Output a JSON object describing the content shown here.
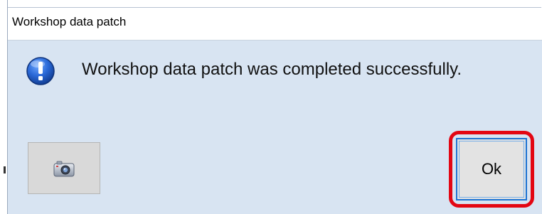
{
  "window": {
    "title": "Workshop data patch"
  },
  "message": {
    "icon": "info-exclamation-icon",
    "text": "Workshop data patch was completed successfully."
  },
  "buttons": {
    "camera_icon": "camera-icon",
    "ok_label": "Ok"
  },
  "colors": {
    "dialog_background": "#d8e4f2",
    "icon_blue": "#1f5fc7",
    "highlight_red": "#e30613",
    "ok_border": "#1e73d2"
  }
}
